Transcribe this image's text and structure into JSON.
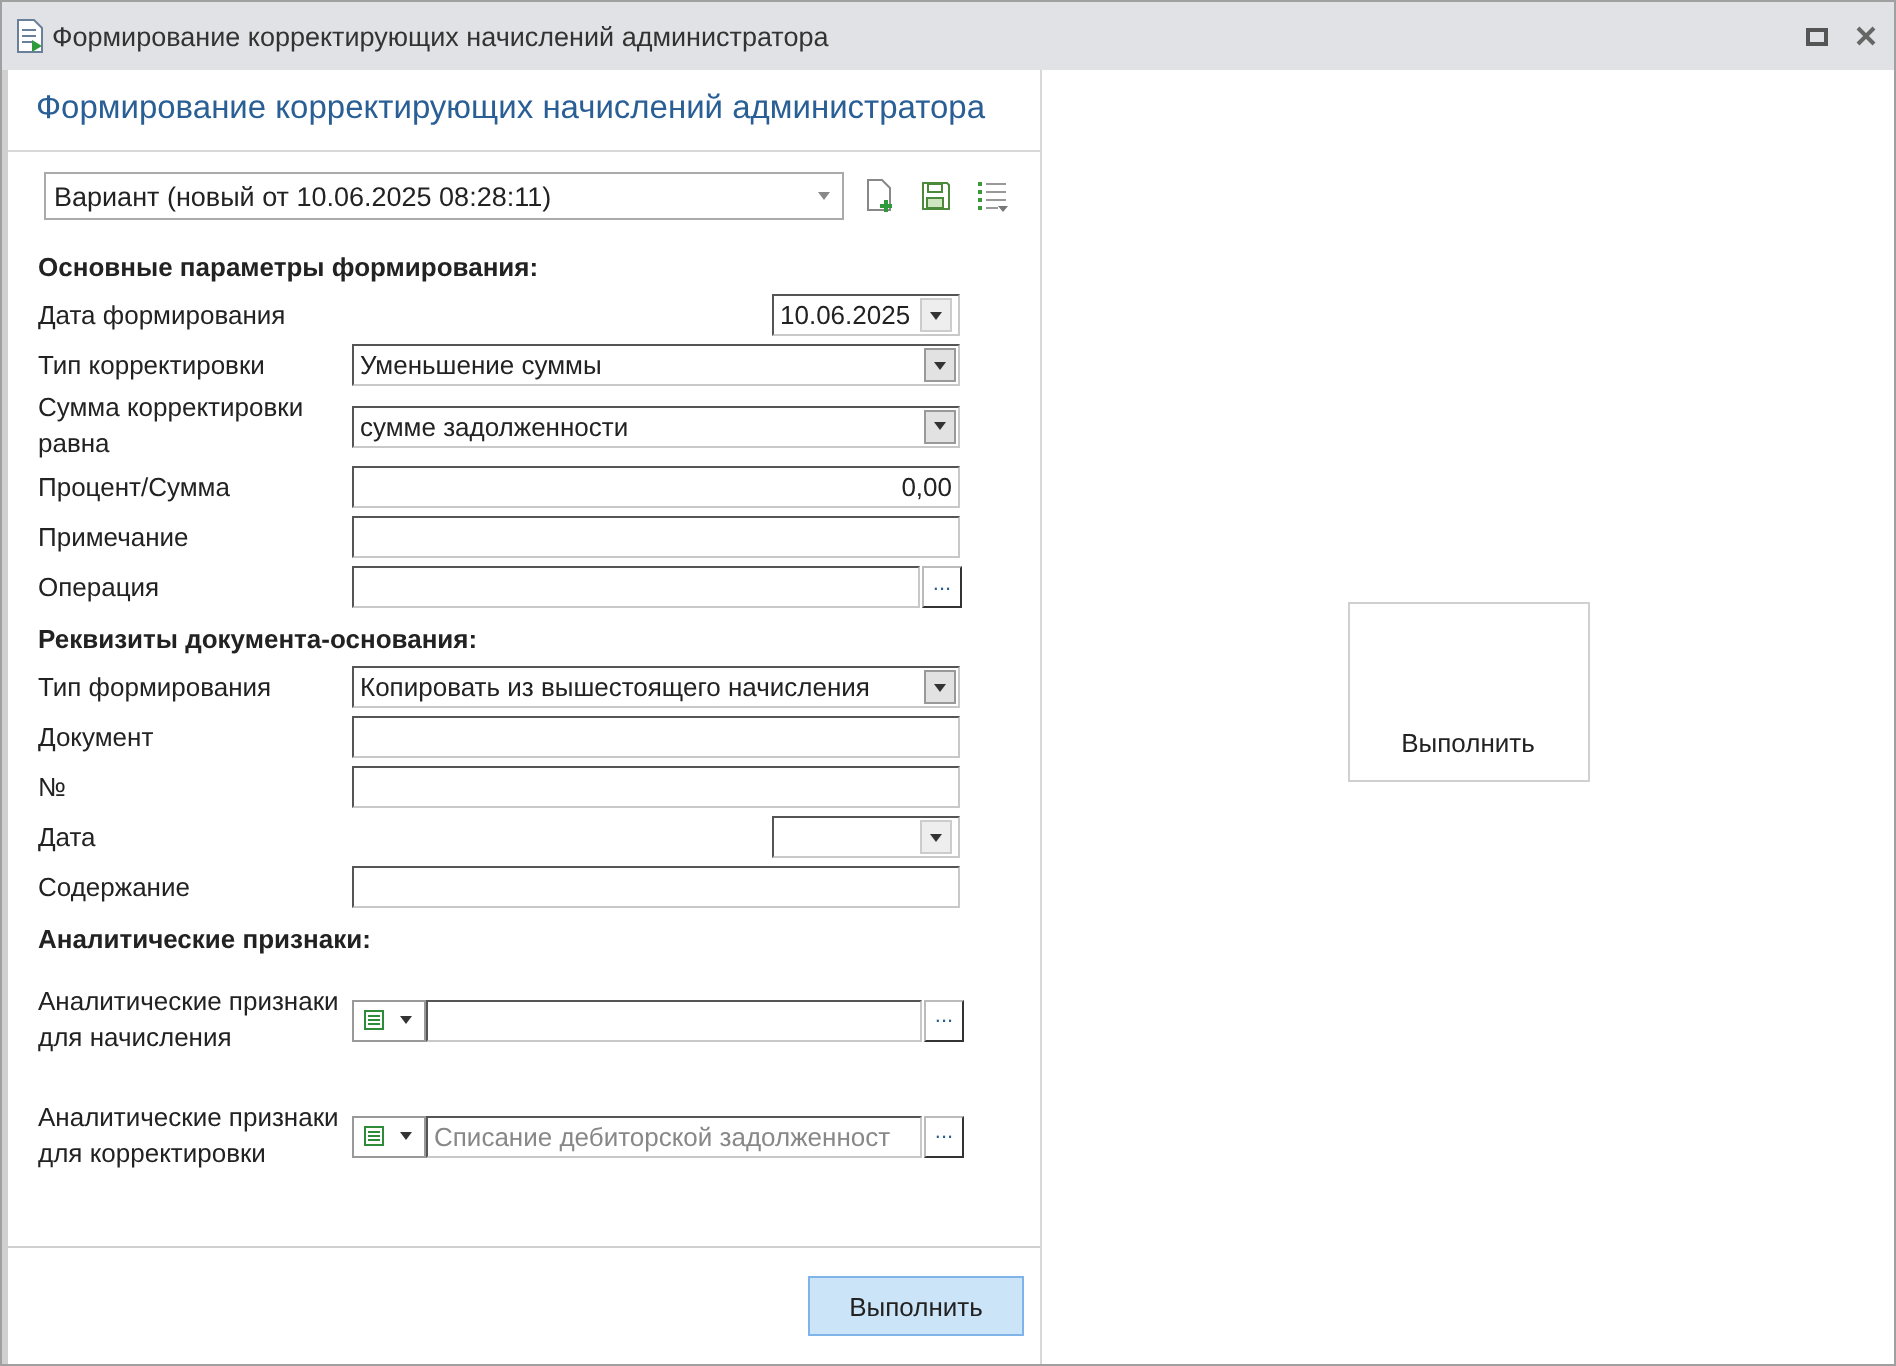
{
  "window": {
    "title": "Формирование корректирующих начислений администратора"
  },
  "panel_title": "Формирование корректирующих начислений администратора",
  "variant": {
    "value": "Вариант (новый от 10.06.2025 08:28:11)"
  },
  "sections": [
    {
      "heading": "Основные параметры формирования:",
      "fields": [
        {
          "kind": "date",
          "label": "Дата формирования",
          "value": "10.06.2025"
        },
        {
          "kind": "select",
          "label": "Тип корректировки",
          "value": "Уменьшение суммы"
        },
        {
          "kind": "select",
          "label": "Сумма корректировки равна",
          "value": "сумме задолженности"
        },
        {
          "kind": "number",
          "label": "Процент/Сумма",
          "value": "0,00"
        },
        {
          "kind": "text",
          "label": "Примечание"
        },
        {
          "kind": "lookup",
          "label": "Операция",
          "button": "..."
        }
      ]
    },
    {
      "heading": "Реквизиты документа-основания:",
      "fields": [
        {
          "kind": "select",
          "label": "Тип формирования",
          "value": "Копировать из вышестоящего начисления"
        },
        {
          "kind": "text",
          "label": "Документ"
        },
        {
          "kind": "text",
          "label": "№"
        },
        {
          "kind": "date",
          "label": "Дата"
        },
        {
          "kind": "text",
          "label": "Содержание"
        }
      ]
    },
    {
      "heading": "Аналитические признаки:",
      "fields": [
        {
          "kind": "analytic",
          "label": "Аналитические признаки для начисления",
          "button": "..."
        },
        {
          "kind": "analytic",
          "label": "Аналитические признаки для корректировки",
          "placeholder": "Списание дебиторской задолженност",
          "button": "..."
        }
      ]
    }
  ],
  "run_button": "Выполнить",
  "tile_button": "Выполнить"
}
